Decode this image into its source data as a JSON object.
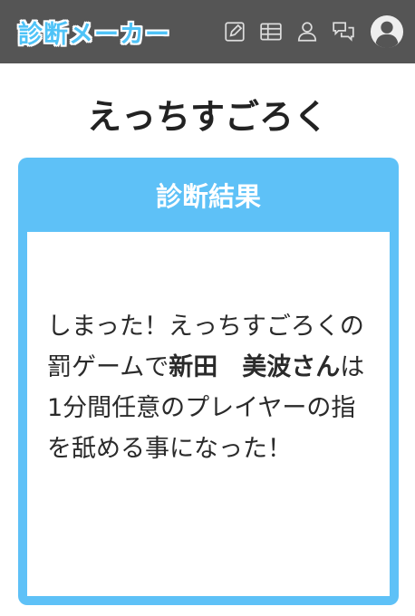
{
  "header": {
    "logo": "診断メーカー",
    "icons": [
      "edit-icon",
      "table-icon",
      "user-icon",
      "chat-icon",
      "avatar-icon"
    ]
  },
  "page": {
    "title": "えっちすごろく"
  },
  "result": {
    "heading": "診断結果",
    "text_before": "しまった！えっちすごろくの罰ゲームで",
    "name": "新田　美波さん",
    "text_after": "は1分間任意のプレイヤーの指を舐める事になった！"
  },
  "colors": {
    "header_bg": "#555555",
    "accent": "#5ec1f7",
    "logo": "#4fc3f7"
  }
}
